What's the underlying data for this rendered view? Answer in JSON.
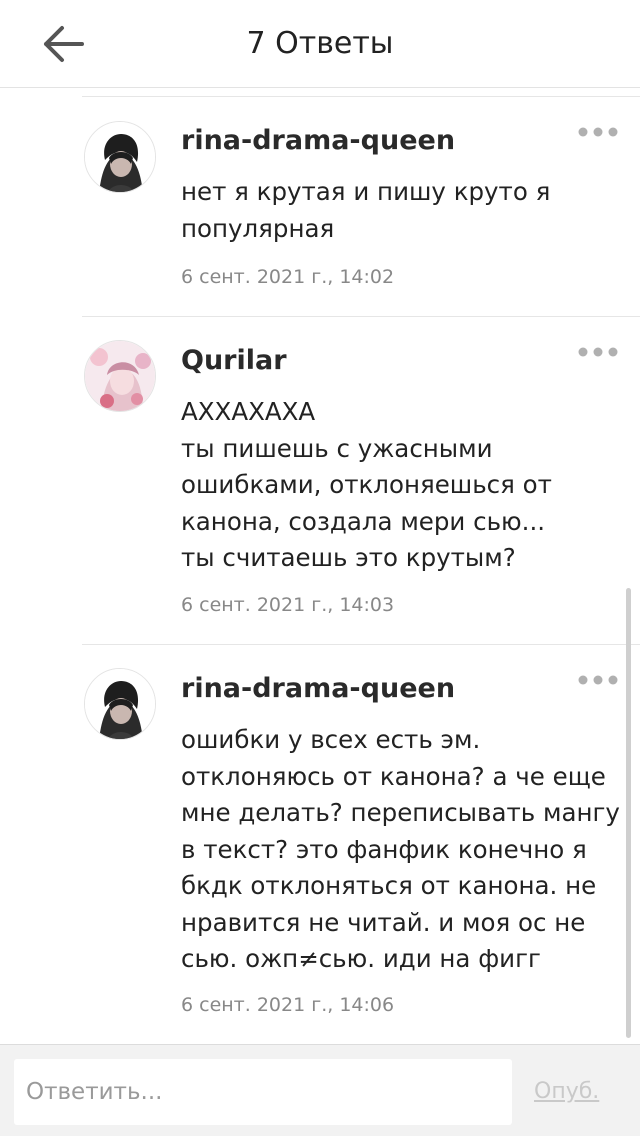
{
  "header": {
    "title": "7 Ответы",
    "back_icon": "arrow-left-icon"
  },
  "comments": [
    {
      "author": "rina-drama-queen",
      "text": "нет я крутая и пишу круто я\nпопулярная",
      "time": "6 сент. 2021 г., 14:02",
      "avatar_icon": "dark-hair-character-avatar"
    },
    {
      "author": "Qurilar",
      "text": "АХХАХАХА\nты пишешь с ужасными\nошибками, отклоняешься от\nканона, создала мери сью...\nты считаешь это крутым?",
      "time": "6 сент. 2021 г., 14:03",
      "avatar_icon": "pink-character-avatar"
    },
    {
      "author": "rina-drama-queen",
      "text": "ошибки у всех есть эм.\nотклоняюсь от канона? а че еще\nмне делать? переписывать мангу\nв текст? это фанфик конечно я\nбкдк отклоняться от канона. не\nнравится не читай. и моя ос не\nсью. ожп≠сью. иди на фигг",
      "time": "6 сент. 2021 г., 14:06",
      "avatar_icon": "dark-hair-character-avatar"
    }
  ],
  "footer": {
    "reply_placeholder": "Ответить...",
    "publish_label": "Опуб."
  },
  "colors": {
    "text": "#222222",
    "muted": "#888888",
    "divider": "#e6e6e6",
    "footer_bg": "#f2f2f2",
    "publish_disabled": "#c9c9c9"
  }
}
